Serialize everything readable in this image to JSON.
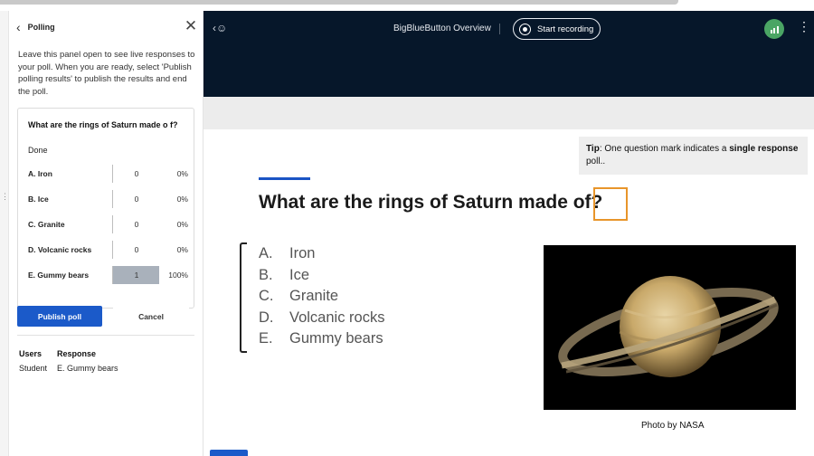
{
  "panel": {
    "title": "Polling",
    "instructions": "Leave this panel open to see live responses to your poll. When you are ready, select 'Publish polling results' to publish the results and end the poll.",
    "question": "What are the rings of Saturn made o f?",
    "status": "Done",
    "answers": [
      {
        "label": "A. Iron",
        "count": "0",
        "percent": "0%",
        "fraction": 0
      },
      {
        "label": "B. Ice",
        "count": "0",
        "percent": "0%",
        "fraction": 0
      },
      {
        "label": "C. Granite",
        "count": "0",
        "percent": "0%",
        "fraction": 0
      },
      {
        "label": "D. Volcanic rocks",
        "count": "0",
        "percent": "0%",
        "fraction": 0
      },
      {
        "label": "E. Gummy bears",
        "count": "1",
        "percent": "100%",
        "fraction": 1
      }
    ],
    "publish_label": "Publish poll",
    "cancel_label": "Cancel",
    "responses": {
      "users_header": "Users",
      "response_header": "Response",
      "rows": [
        {
          "user": "Student",
          "response": "E. Gummy bears"
        }
      ]
    }
  },
  "topbar": {
    "meeting_title": "BigBlueButton Overview",
    "record_label": "Start recording",
    "connection_color": "#4aa564"
  },
  "slide": {
    "tip_prefix": "Tip",
    "tip_text_1": ": One question mark indicates a ",
    "tip_bold": "single response",
    "tip_text_2": " poll..",
    "question_main": "What are the rings of Saturn made ",
    "question_end": "of?",
    "options": [
      {
        "letter": "A.",
        "text": "Iron"
      },
      {
        "letter": "B.",
        "text": "Ice"
      },
      {
        "letter": "C.",
        "text": "Granite"
      },
      {
        "letter": "D.",
        "text": "Volcanic rocks"
      },
      {
        "letter": "E.",
        "text": "Gummy bears"
      }
    ],
    "photo_credit": "Photo by NASA"
  },
  "colors": {
    "accent": "#1b5ac9",
    "highlight": "#e8952a",
    "topbar": "#06172a"
  }
}
